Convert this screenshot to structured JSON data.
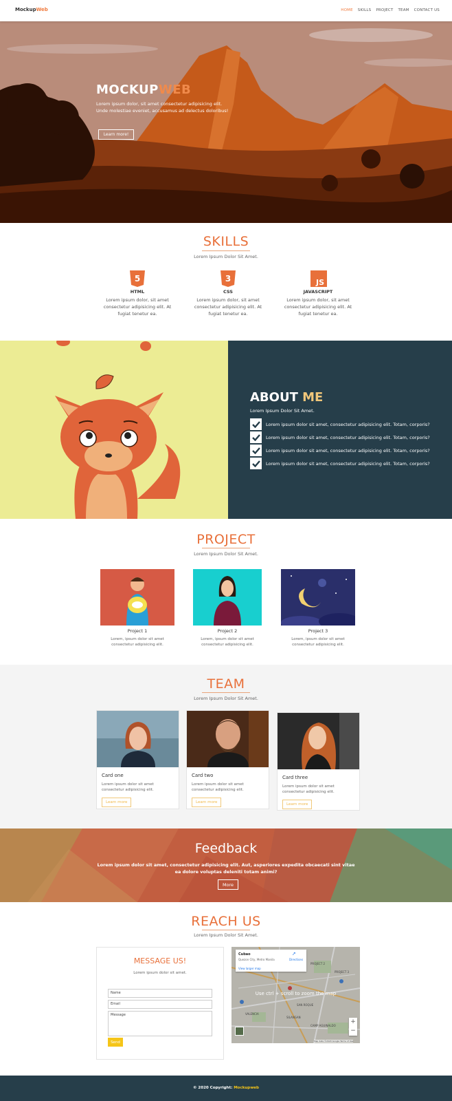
{
  "nav": {
    "brand_main": "Mockup",
    "brand_accent": "Web",
    "links": [
      "HOME",
      "SKILLS",
      "PROJECT",
      "TEAM",
      "CONTACT US"
    ]
  },
  "hero": {
    "title_main": "MOCKUP",
    "title_accent": "WEB",
    "text": "Lorem ipsum dolor, sit amet consectetur adipisicing elit. Unde molestiae eveniet, accusamus ad delectus doloribus!",
    "button": "Learn more!"
  },
  "skills": {
    "title": "SKILLS",
    "subtitle": "Lorem Ipsum Dolor Sit Amet.",
    "items": [
      {
        "icon": "html5-icon",
        "name": "HTML",
        "desc": "Lorem ipsum dolor, sit amet consectetur adipisicing elit. At fugiat tenetur ea."
      },
      {
        "icon": "css3-icon",
        "name": "CSS",
        "desc": "Lorem ipsum dolor, sit amet consectetur adipisicing elit. At fugiat tenetur ea."
      },
      {
        "icon": "js-icon",
        "name": "JAVASCRIPT",
        "desc": "Lorem ipsum dolor, sit amet consectetur adipisicing elit. At fugiat tenetur ea."
      }
    ]
  },
  "about": {
    "title_main": "ABOUT",
    "title_accent": "ME",
    "subtitle": "Lorem Ipsum Dolor Sit Amet.",
    "items": [
      "Lorem ipsum dolor sit amet, consectetur adipisicing elit. Totam, corporis?",
      "Lorem ipsum dolor sit amet, consectetur adipisicing elit. Totam, corporis?",
      "Lorem ipsum dolor sit amet, consectetur adipisicing elit. Totam, corporis?",
      "Lorem ipsum dolor sit amet, consectetur adipisicing elit. Totam, corporis?"
    ]
  },
  "project": {
    "title": "PROJECT",
    "subtitle": "Lorem Ipsum Dolor Sit Amet.",
    "items": [
      {
        "name": "Project 1",
        "desc": "Lorem, ipsum dolor sit amet consectetur adipisicing elit."
      },
      {
        "name": "Project 2",
        "desc": "Lorem, ipsum dolor sit amet consectetur adipisicing elit."
      },
      {
        "name": "Project 3",
        "desc": "Lorem, ipsum dolor sit amet consectetur adipisicing elit."
      }
    ]
  },
  "team": {
    "title": "TEAM",
    "subtitle": "Lorem Ipsum Dolor Sit Amet.",
    "cards": [
      {
        "title": "Card one",
        "desc": "Lorem ipsum dolor sit amet consectetur adipisicing elit.",
        "button": "Learn more"
      },
      {
        "title": "Card two",
        "desc": "Lorem ipsum dolor sit amet consectetur adipisicing elit.",
        "button": "Learn more"
      },
      {
        "title": "Card three",
        "desc": "Lorem ipsum dolor sit amet consectetur adipisicing elit.",
        "button": "Learn more"
      }
    ]
  },
  "feedback": {
    "title": "Feedback",
    "text": "Lorem ipsum dolor sit amet, consectetur adipisicing elit. Aut, asperiores expedita obcaecati sint vitae ea dolore voluptas deleniti totam animi?",
    "button": "More"
  },
  "reach": {
    "title": "REACH US",
    "subtitle": "Lorem Ipsum Dolor Sit Amet.",
    "message_title": "MESSAGE US!",
    "message_sub": "Lorem ipsum dolor sit amet.",
    "name_placeholder": "Name",
    "email_placeholder": "Email",
    "message_placeholder": "Message",
    "send": "Send",
    "map": {
      "place": "Cubao",
      "address": "Quezon City, Metro Manila",
      "directions": "Directions",
      "larger": "View larger map",
      "hint": "Use ctrl + scroll to zoom the map",
      "zoom_in": "+",
      "zoom_out": "−",
      "credits": "Map data ©2020 Google",
      "terms": "Terms of Use",
      "labels": [
        "PROJECT 2",
        "PROJECT 3",
        "SAN ROQUE",
        "CAMP AGUINALDO",
        "SILANGAN",
        "VALENCIA"
      ]
    }
  },
  "footer": {
    "text": "© 2020 Copyright:",
    "link": "Mockupweb"
  },
  "colors": {
    "accent": "#f07b3f",
    "dark": "#263e4a",
    "yellow": "#f5c518"
  }
}
